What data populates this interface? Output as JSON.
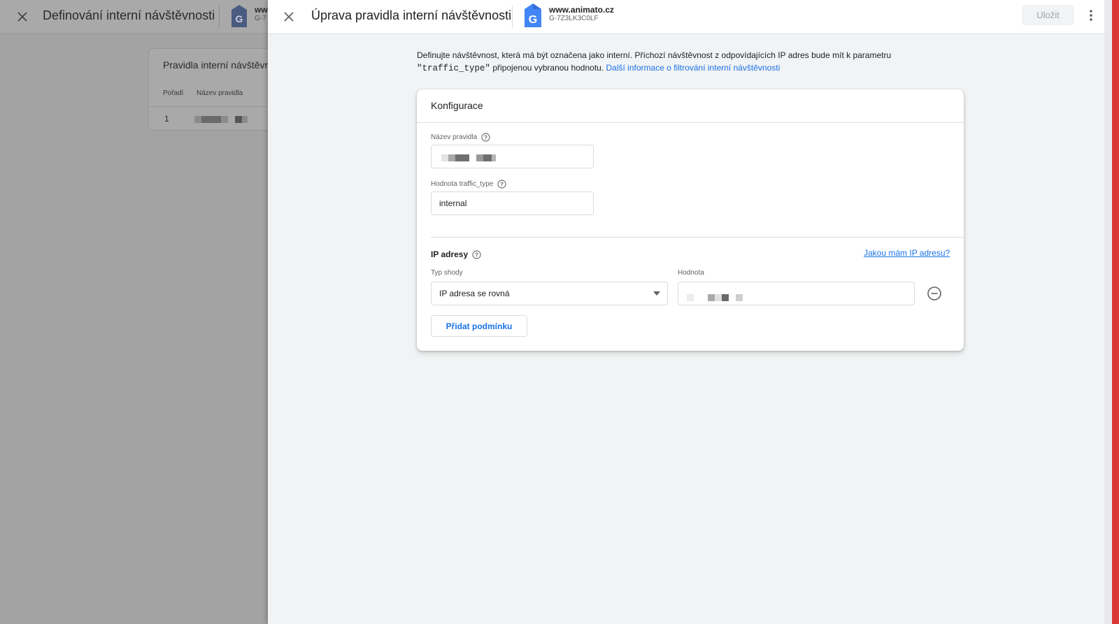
{
  "background_panel": {
    "title": "Definování interní návštěvnosti",
    "property_name": "ww",
    "property_id": "G-7",
    "card_title": "Pravidla interní návštěvn",
    "columns": [
      "Pořadí",
      "Název pravidla"
    ],
    "rows": [
      {
        "order": "1"
      }
    ]
  },
  "drawer": {
    "title": "Úprava pravidla interní návštěvnosti",
    "property_name": "www.animato.cz",
    "property_id": "G-7Z3LK3C0LF",
    "save_label": "Uložit",
    "intro_part1": "Definujte návštěvnost, která má být označena jako interní. Příchozí návštěvnost z odpovídajících IP adres bude mít k parametru ",
    "intro_code": "\"traffic_type\"",
    "intro_part2": " připojenou vybranou hodnotu. ",
    "intro_link": "Další informace o filtrování interní návštěvnosti",
    "card": {
      "title": "Konfigurace",
      "rule_name_label": "Název pravidla",
      "traffic_type_label": "Hodnota traffic_type",
      "traffic_type_value": "internal",
      "ip_section_title": "IP adresy",
      "ip_help_link": "Jakou mám IP adresu?",
      "match_type_label": "Typ shody",
      "match_type_value": "IP adresa se rovná",
      "value_label": "Hodnota",
      "add_condition_label": "Přidat podmínku"
    }
  },
  "icons": {
    "close": "close-icon",
    "ga_logo": "google-analytics-tag-icon",
    "help": "help-circle-icon",
    "more": "more-vert-icon",
    "remove": "remove-circle-icon",
    "dropdown": "arrow-drop-down-icon"
  },
  "colors": {
    "accent": "#1a73e8",
    "ga_blue": "#4285f4",
    "disabled_text": "#a0a4a8",
    "scrim": "#a3a3a3"
  }
}
